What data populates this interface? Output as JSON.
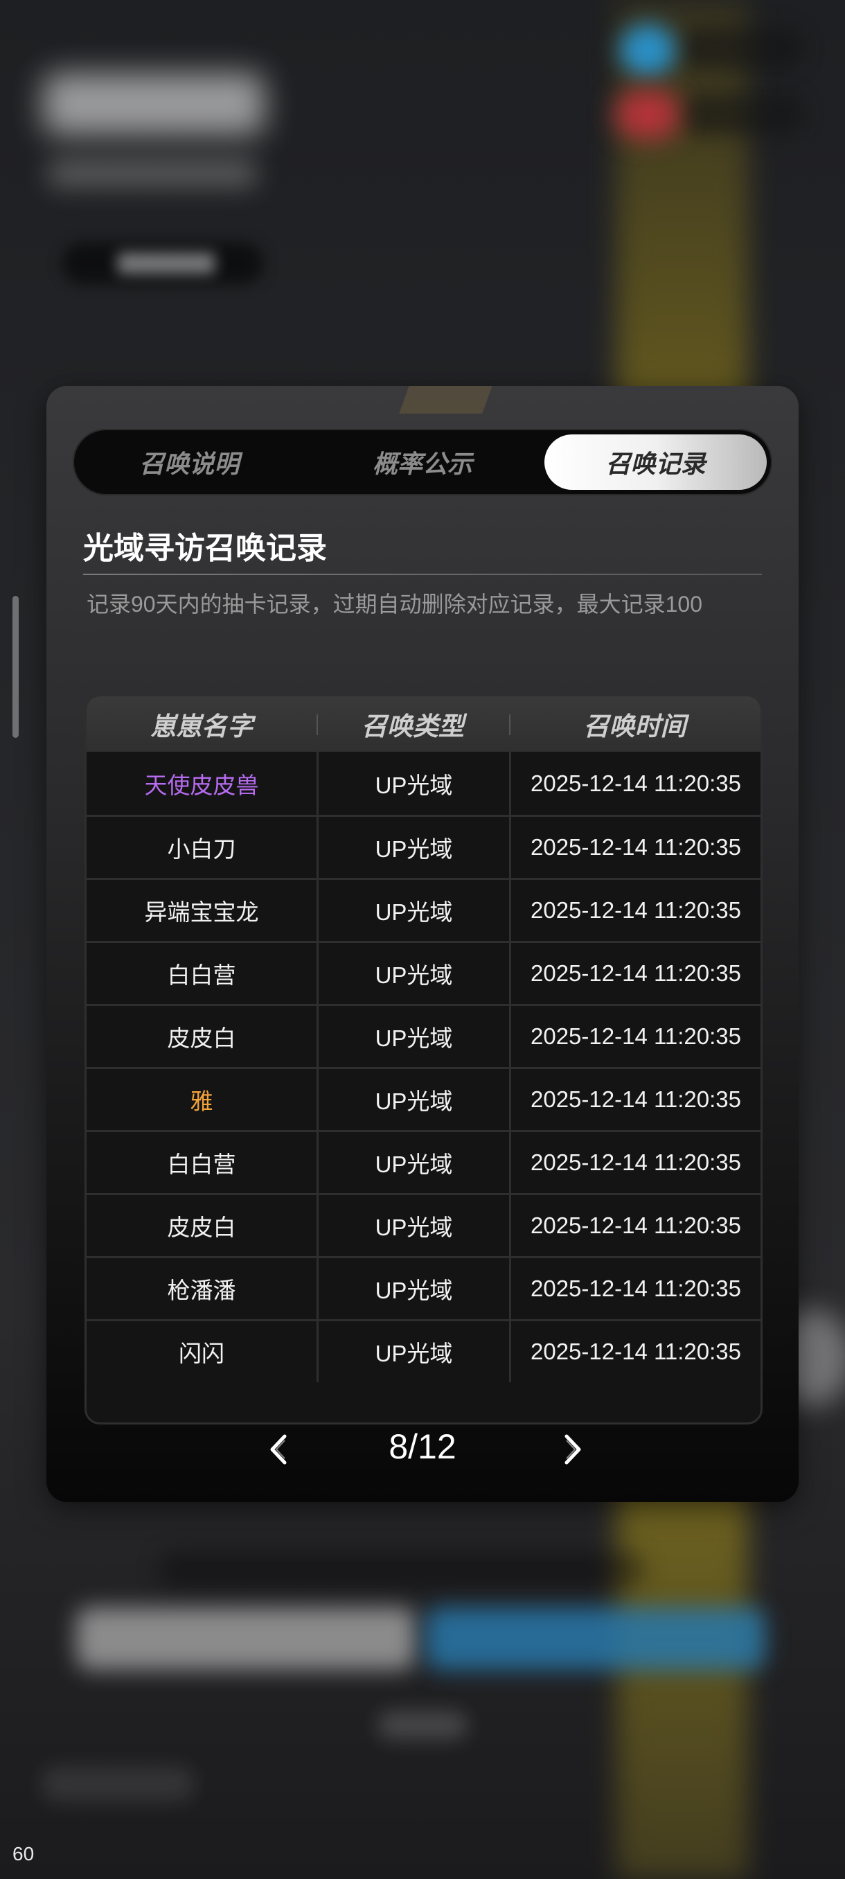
{
  "tabs": [
    {
      "label": "召唤说明",
      "active": false
    },
    {
      "label": "概率公示",
      "active": false
    },
    {
      "label": "召唤记录",
      "active": true
    }
  ],
  "record": {
    "title": "光域寻访召唤记录",
    "description": "记录90天内的抽卡记录，过期自动删除对应记录，最大记录100"
  },
  "table": {
    "headers": [
      "崽崽名字",
      "召唤类型",
      "召唤时间"
    ],
    "rows": [
      {
        "name": "天使皮皮兽",
        "type": "UP光域",
        "time": "2025-12-14 11:20:35",
        "color": "#b76bf0"
      },
      {
        "name": "小白刀",
        "type": "UP光域",
        "time": "2025-12-14 11:20:35",
        "color": "#f2f2f2"
      },
      {
        "name": "异端宝宝龙",
        "type": "UP光域",
        "time": "2025-12-14 11:20:35",
        "color": "#f2f2f2"
      },
      {
        "name": "白白营",
        "type": "UP光域",
        "time": "2025-12-14 11:20:35",
        "color": "#f2f2f2"
      },
      {
        "name": "皮皮白",
        "type": "UP光域",
        "time": "2025-12-14 11:20:35",
        "color": "#f2f2f2"
      },
      {
        "name": "雅",
        "type": "UP光域",
        "time": "2025-12-14 11:20:35",
        "color": "#f3a33b"
      },
      {
        "name": "白白营",
        "type": "UP光域",
        "time": "2025-12-14 11:20:35",
        "color": "#f2f2f2"
      },
      {
        "name": "皮皮白",
        "type": "UP光域",
        "time": "2025-12-14 11:20:35",
        "color": "#f2f2f2"
      },
      {
        "name": "枪潘潘",
        "type": "UP光域",
        "time": "2025-12-14 11:20:35",
        "color": "#f2f2f2"
      },
      {
        "name": "闪闪",
        "type": "UP光域",
        "time": "2025-12-14 11:20:35",
        "color": "#f2f2f2"
      }
    ]
  },
  "pager": {
    "current": "8/12",
    "prev_icon": "chevron-left-icon",
    "next_icon": "chevron-right-icon"
  },
  "fps": "60"
}
